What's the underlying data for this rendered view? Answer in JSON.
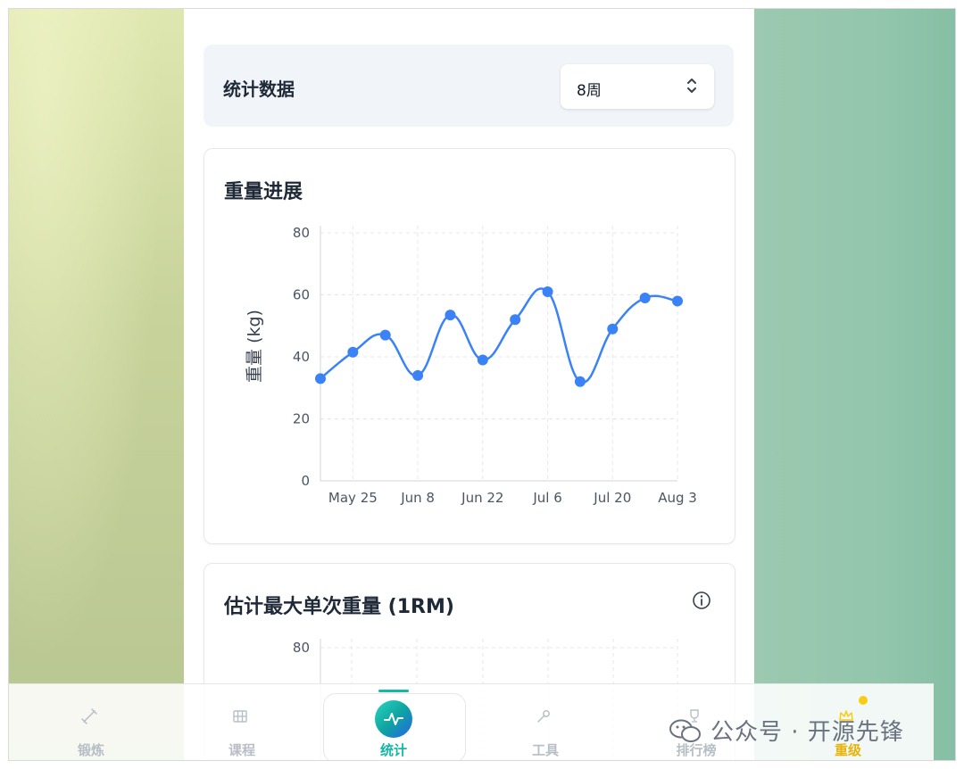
{
  "header": {
    "title": "统计数据",
    "period_select": {
      "value": "8周"
    }
  },
  "weight_card": {
    "title": "重量进展"
  },
  "orm_card": {
    "title": "估计最大单次重量 (1RM)",
    "ytick_top": "80"
  },
  "chart_data": {
    "type": "line",
    "ylabel": "重量 (kg)",
    "ylim": [
      0,
      80
    ],
    "yticks": [
      "0",
      "20",
      "40",
      "60",
      "80"
    ],
    "x_tick_labels": [
      "May 25",
      "Jun 8",
      "Jun 22",
      "Jul 6",
      "Jul 20",
      "Aug 3"
    ],
    "xlim": [
      "2024-05-18",
      "2024-08-03"
    ],
    "grid": true,
    "series": [
      {
        "color": "#3b82f6",
        "x": [
          "2024-05-18",
          "2024-05-25",
          "2024-06-01",
          "2024-06-08",
          "2024-06-15",
          "2024-06-22",
          "2024-06-29",
          "2024-07-06",
          "2024-07-13",
          "2024-07-20",
          "2024-07-27",
          "2024-08-03"
        ],
        "y": [
          33,
          41.5,
          47,
          34,
          53.5,
          39,
          52,
          61,
          32,
          49,
          59,
          58
        ]
      }
    ]
  },
  "nav": {
    "items": [
      {
        "label": "锻炼",
        "icon": "dumbbell-icon"
      },
      {
        "label": "课程",
        "icon": "grid-icon"
      },
      {
        "label": "统计",
        "icon": "activity-icon",
        "active": true
      },
      {
        "label": "工具",
        "icon": "wrench-icon"
      },
      {
        "label": "排行榜",
        "icon": "trophy-icon"
      },
      {
        "label": "重级",
        "icon": "crown-icon"
      }
    ]
  },
  "watermark": {
    "text": "公众号 · 开源先锋"
  },
  "colors": {
    "accent": "#3b82f6",
    "active_nav": "#14b8a6"
  }
}
